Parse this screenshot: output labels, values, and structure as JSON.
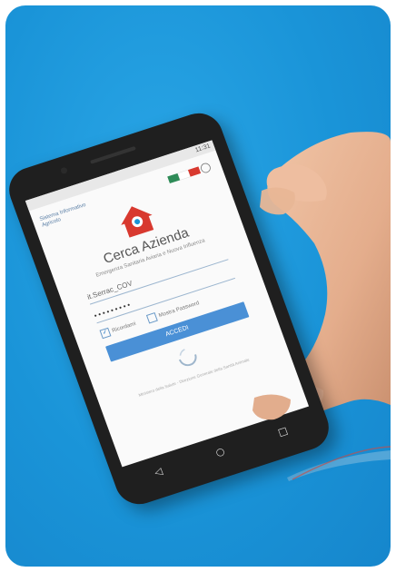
{
  "screen": {
    "status_time": "11:31",
    "brand_text": "Sistema Informativo Agricolo",
    "title": "Cerca Azienda",
    "subtitle": "Emergenza Sanitaria Aviaria e Nuova Influenza",
    "username_value": "it.Serrac_COV",
    "password_value": "•••••••••",
    "remember_label": "Ricordami",
    "show_password_label": "Mostra Password",
    "login_label": "ACCEDI",
    "footer_note": "Ministero della Salute - Direzione Generale della Sanità Animale"
  },
  "nav": {
    "back_glyph": "◁",
    "home_glyph": "○",
    "recent_glyph": "□"
  },
  "colors": {
    "background_blue": "#1a94d8",
    "accent": "#4a90d6",
    "icon_red": "#d8392f"
  }
}
